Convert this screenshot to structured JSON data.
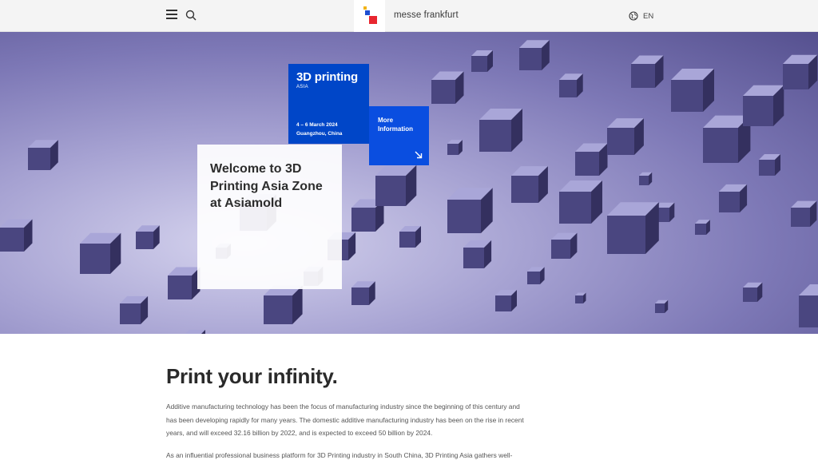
{
  "header": {
    "brand": "messe frankfurt",
    "language": "EN",
    "logo_colors": [
      "#e8262f",
      "#1f4fd1",
      "#f2b318"
    ]
  },
  "hero": {
    "event": {
      "title": "3D printing",
      "subtitle": "ASIA",
      "date": "4 – 6 March 2024",
      "location": "Guangzhou, China"
    },
    "more_info": "More Information",
    "welcome": "Welcome to 3D Printing Asia Zone at Asiamold"
  },
  "content": {
    "title": "Print your infinity.",
    "paragraph1": "Additive manufacturing technology has been the focus of manufacturing industry since the beginning of this century and has been developing rapidly for many years. The domestic additive manufacturing industry has been on the rise in recent years, and will exceed 32.16 billion by 2022, and is expected to exceed 50 billion by 2024.",
    "paragraph2": "As an influential professional business platform for 3D Printing industry in South China, 3D Printing Asia gathers well-"
  },
  "colors": {
    "accent_dark_blue": "#0046c8",
    "accent_blue": "#0a4ee0",
    "hero_purple": "#7d78b6"
  }
}
